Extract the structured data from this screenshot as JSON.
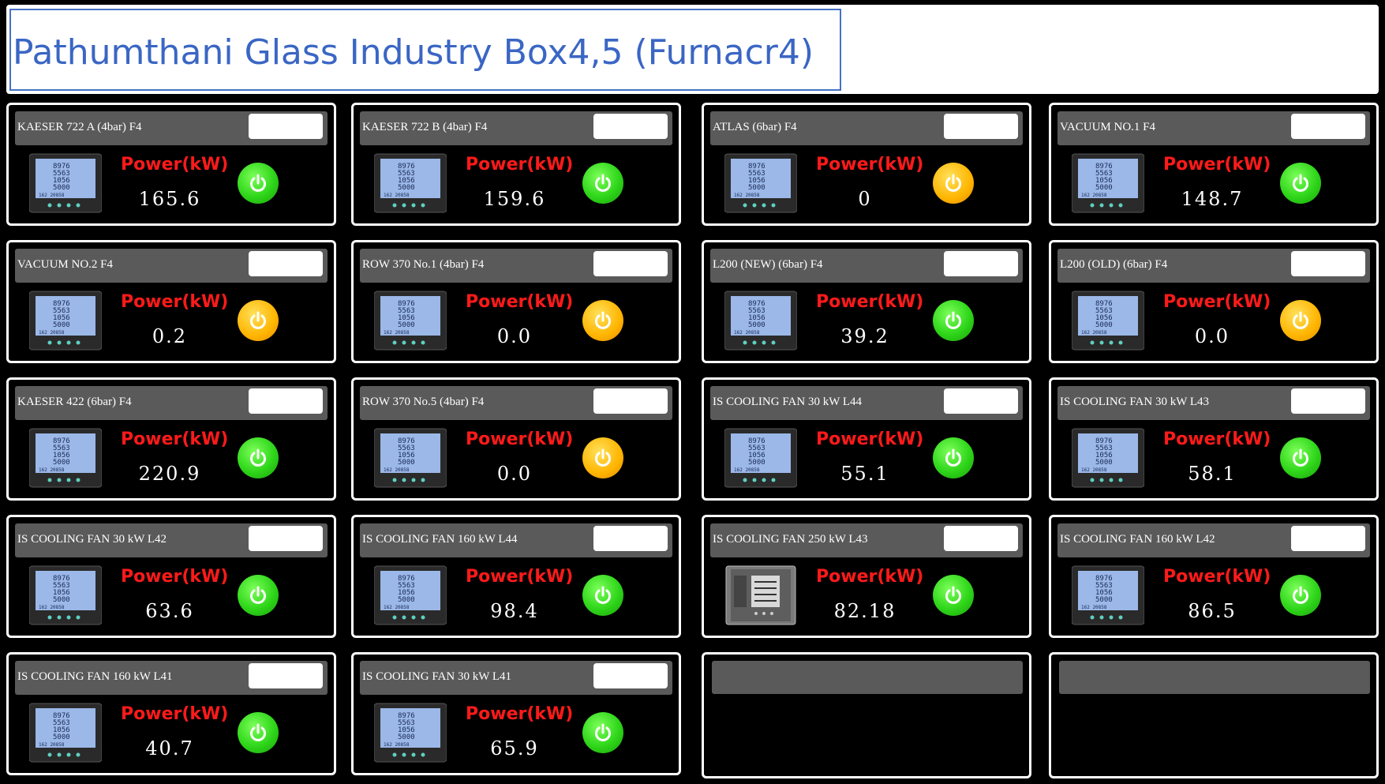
{
  "header": {
    "title": "Pathumthani Glass Industry Box4,5 (Furnacr4)"
  },
  "power_label": "Power(kW)",
  "status_colors": {
    "running": "#2fd61a",
    "idle": "#ffb400"
  },
  "cards": [
    {
      "name": "KAESER 722 A (4bar) F4",
      "value": "165.6",
      "status": "running",
      "meter": "lcd-meter-icon"
    },
    {
      "name": "KAESER 722 B (4bar) F4",
      "value": "159.6",
      "status": "running",
      "meter": "lcd-meter-icon"
    },
    {
      "name": "ATLAS (6bar) F4",
      "value": "0",
      "status": "idle",
      "meter": "lcd-meter-icon"
    },
    {
      "name": "VACUUM NO.1 F4",
      "value": "148.7",
      "status": "running",
      "meter": "lcd-meter-icon"
    },
    {
      "name": "VACUUM NO.2 F4",
      "value": "0.2",
      "status": "idle",
      "meter": "lcd-meter-icon"
    },
    {
      "name": "ROW 370 No.1 (4bar) F4",
      "value": "0.0",
      "status": "idle",
      "meter": "lcd-meter-icon"
    },
    {
      "name": "L200 (NEW) (6bar) F4",
      "value": "39.2",
      "status": "running",
      "meter": "lcd-meter-icon"
    },
    {
      "name": "L200 (OLD) (6bar) F4",
      "value": "0.0",
      "status": "idle",
      "meter": "lcd-meter-icon"
    },
    {
      "name": "KAESER 422 (6bar) F4",
      "value": "220.9",
      "status": "running",
      "meter": "lcd-meter-icon"
    },
    {
      "name": "ROW 370 No.5 (4bar) F4",
      "value": "0.0",
      "status": "idle",
      "meter": "lcd-meter-icon"
    },
    {
      "name": "IS COOLING FAN 30 kW L44",
      "value": "55.1",
      "status": "running",
      "meter": "lcd-meter-icon"
    },
    {
      "name": "IS COOLING FAN 30 kW L43",
      "value": "58.1",
      "status": "running",
      "meter": "lcd-meter-icon"
    },
    {
      "name": "IS COOLING FAN 30 kW L42",
      "value": "63.6",
      "status": "running",
      "meter": "lcd-meter-icon"
    },
    {
      "name": "IS COOLING FAN 160 kW L44",
      "value": "98.4",
      "status": "running",
      "meter": "lcd-meter-icon"
    },
    {
      "name": "IS COOLING FAN 250 kW L43",
      "value": "82.18",
      "status": "running",
      "meter": "panel-meter-icon"
    },
    {
      "name": "IS COOLING FAN 160 kW L42",
      "value": "86.5",
      "status": "running",
      "meter": "lcd-meter-icon"
    },
    {
      "name": "IS COOLING FAN 160 kW L41",
      "value": "40.7",
      "status": "running",
      "meter": "lcd-meter-icon"
    },
    {
      "name": "IS COOLING FAN 30 kW L41",
      "value": "65.9",
      "status": "running",
      "meter": "lcd-meter-icon"
    }
  ]
}
